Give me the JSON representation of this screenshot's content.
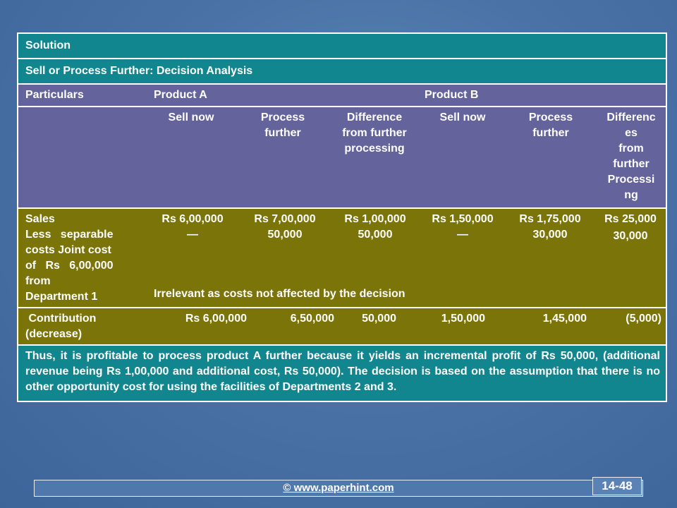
{
  "table": {
    "solution": "Solution",
    "title": "Sell or Process Further: Decision Analysis",
    "particulars": "Particulars",
    "product_a": "Product A",
    "product_b": "Product B",
    "sub_headers": {
      "a_sell_now": "Sell now",
      "a_process_further": [
        "Process",
        "further"
      ],
      "a_difference": [
        "Difference",
        "from further",
        "processing"
      ],
      "b_sell_now": "Sell now",
      "b_process_further": [
        "Process",
        "further"
      ],
      "b_difference": [
        "Differenc",
        "es",
        "from",
        "further",
        "Processi",
        "ng"
      ]
    },
    "sales_row": {
      "label_lines": [
        "Sales",
        "Less   separable",
        "costs Joint cost",
        "of   Rs   6,00,000",
        "from",
        "Department 1"
      ],
      "a_sell_now": [
        "Rs 6,00,000",
        "—"
      ],
      "a_process_further": [
        "Rs 7,00,000",
        "50,000"
      ],
      "a_difference": [
        "Rs 1,00,000",
        "50,000"
      ],
      "b_sell_now": [
        "Rs 1,50,000",
        "—"
      ],
      "b_process_further": [
        "Rs 1,75,000",
        "30,000"
      ],
      "b_difference": [
        "Rs 25,000",
        "30,000"
      ],
      "irrelevant_note": "Irrelevant as costs not affected by the decision"
    },
    "contribution_row": {
      "label_lines": [
        " Contribution",
        "(decrease)"
      ],
      "a_sell_now": "Rs 6,00,000",
      "a_process_further": "6,50,000",
      "a_difference": "50,000",
      "b_sell_now": "1,50,000",
      "b_process_further": "1,45,000",
      "b_difference": "(5,000)"
    },
    "conclusion": "Thus, it is profitable to process product A further because it yields an incremental profit of Rs 50,000, (additional revenue being Rs 1,00,000 and additional cost, Rs 50,000). The decision is based on the assumption that there is no other opportunity cost for using the facilities of Departments 2 and 3."
  },
  "footer": {
    "link": "© www.paperhint.com",
    "page_number": "14-48"
  }
}
